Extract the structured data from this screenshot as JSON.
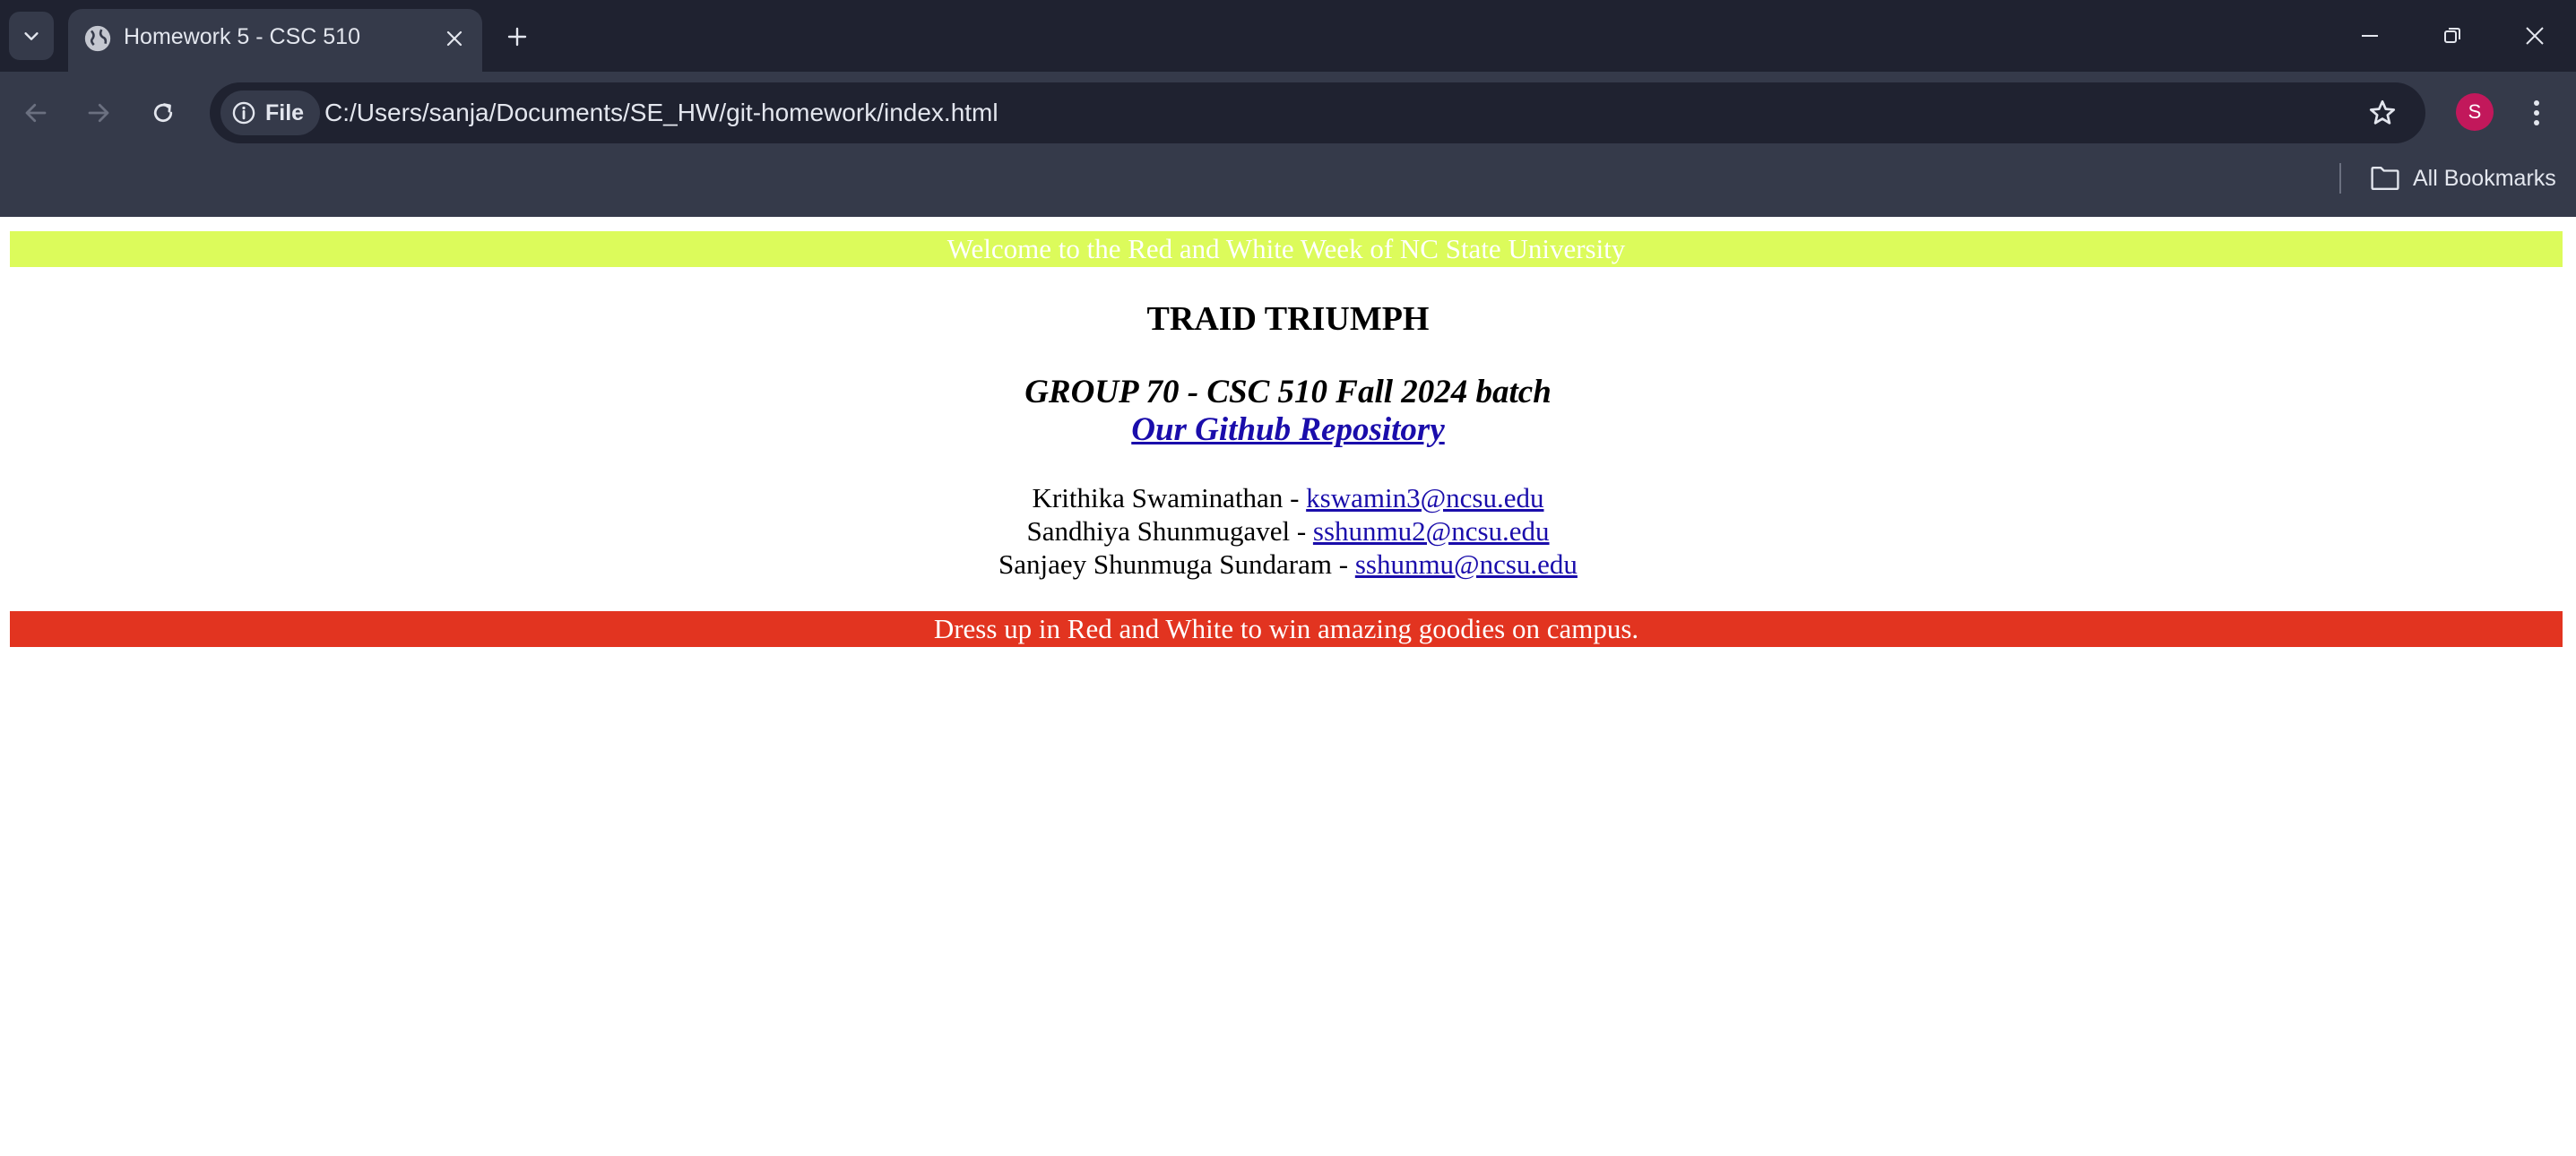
{
  "browser": {
    "tab_title": "Homework 5 - CSC 510",
    "site_info_label": "File",
    "url": "C:/Users/sanja/Documents/SE_HW/git-homework/index.html",
    "profile_initial": "S",
    "bookmarks_label": "All Bookmarks",
    "colors": {
      "tabstrip": "#1f2230",
      "toolbar": "#353a4a",
      "avatar": "#c2185b"
    }
  },
  "page": {
    "top_banner": "Welcome to the Red and White Week of NC State University",
    "title": "TRAID TRIUMPH",
    "subtitle": "GROUP 70 - CSC 510 Fall 2024 batch",
    "repo_link": "Our Github Repository",
    "members": [
      {
        "name": "Krithika Swaminathan - ",
        "email": "kswamin3@ncsu.edu"
      },
      {
        "name": "Sandhiya Shunmugavel - ",
        "email": "sshunmu2@ncsu.edu"
      },
      {
        "name": "Sanjaey Shunmuga Sundaram - ",
        "email": "sshunmu@ncsu.edu"
      }
    ],
    "bottom_banner": "Dress up in Red and White to win amazing goodies on campus.",
    "colors": {
      "top_banner": "#dcfb5b",
      "bottom_banner": "#e23420",
      "link": "#1a0dab"
    }
  }
}
